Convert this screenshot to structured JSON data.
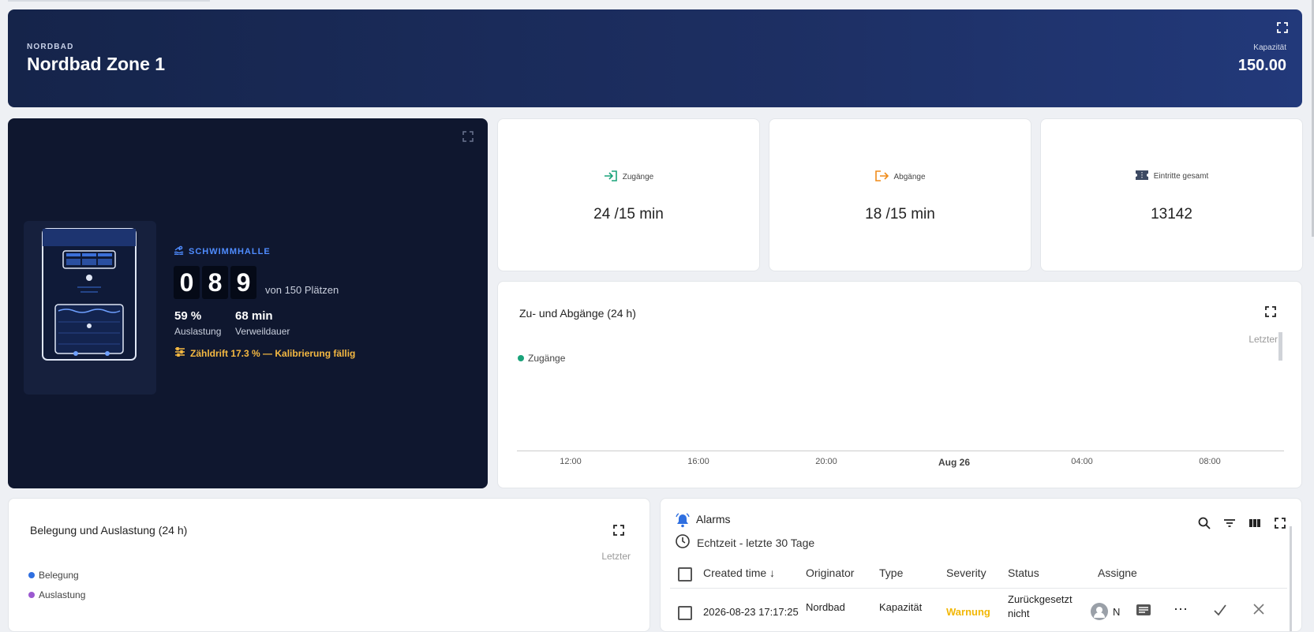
{
  "header": {
    "kicker": "NORDBAD",
    "title": "Nordbad Zone 1",
    "capacity_label": "Kapazität",
    "capacity_value": "150.00"
  },
  "hero": {
    "zone_label": "SCHWIMMHALLE",
    "digits": [
      "0",
      "8",
      "9"
    ],
    "of_text": "von 150 Plätzen",
    "utilization_value": "59 %",
    "utilization_label": "Auslastung",
    "dwell_value": "68 min",
    "dwell_label": "Verweildauer",
    "drift_text": "Zähldrift 17.3 % — Kalibrierung fällig"
  },
  "stats": [
    {
      "label": "Zugänge",
      "value": "24 /15 min",
      "icon": "login-icon",
      "color": "#1aa37a"
    },
    {
      "label": "Abgänge",
      "value": "18 /15 min",
      "icon": "logout-icon",
      "color": "#f08c1a"
    },
    {
      "label": "Eintritte gesamt",
      "value": "13142",
      "icon": "ticket-icon",
      "color": "#3d4a63"
    }
  ],
  "flow_chart": {
    "title": "Zu- und Abgänge (24 h)",
    "legend": "Zugänge",
    "legend_color": "#1aa37a",
    "letzter": "Letzter",
    "ticks": [
      "12:00",
      "16:00",
      "20:00",
      "Aug 26",
      "04:00",
      "08:00"
    ]
  },
  "occupancy_chart": {
    "title": "Belegung und Auslastung (24 h)",
    "letzter": "Letzter",
    "legend": [
      {
        "label": "Belegung",
        "color": "#2f6fe0"
      },
      {
        "label": "Auslastung",
        "color": "#9b59d0"
      }
    ]
  },
  "alarms": {
    "title": "Alarms",
    "realtime": "Echtzeit - letzte 30 Tage",
    "columns": [
      "Created time",
      "Originator",
      "Type",
      "Severity",
      "Status",
      "Assigne"
    ],
    "row": {
      "created": "2026-08-23 17:17:25",
      "originator": "Nordbad",
      "type": "Kapazität",
      "severity": "Warnung",
      "status_line1": "Zurückgesetzt",
      "status_line2": "nicht",
      "assignee": "N"
    }
  }
}
